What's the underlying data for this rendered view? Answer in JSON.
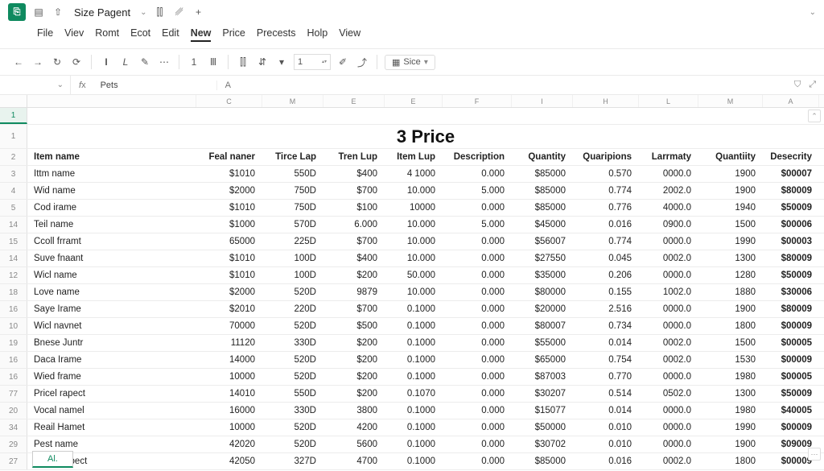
{
  "titlebar": {
    "app_glyph": "⎘",
    "doc_title": "Size Pagent"
  },
  "menubar": [
    "File",
    "Viev",
    "Romt",
    "Ecot",
    "Edit",
    "New",
    "Price",
    "Precests",
    "Holp",
    "View"
  ],
  "menubar_active_index": 5,
  "toolbar": {
    "num_value": "1",
    "size_label": "Sice"
  },
  "formula": {
    "namebox": "",
    "value": "Pets"
  },
  "column_letters": [
    "",
    "C",
    "M",
    "E",
    "E",
    "F",
    "I",
    "H",
    "L",
    "M",
    "A"
  ],
  "sheet_title": "3 Price",
  "headers": [
    "Item name",
    "Feal naner",
    "Tirce Lap",
    "Tren Lup",
    "Item Lup",
    "Description",
    "Quantity",
    "Quaripions",
    "Larrmaty",
    "Quantiity",
    "Desecrity"
  ],
  "row_numbers": [
    "1",
    "1",
    "2",
    "3",
    "4",
    "5",
    "14",
    "15",
    "14",
    "12",
    "18",
    "16",
    "10",
    "19",
    "16",
    "16",
    "77",
    "20",
    "34",
    "29",
    "27"
  ],
  "rows": [
    [
      "Ittm name",
      "$1010",
      "550D",
      "$400",
      "4 1000",
      "0.000",
      "$85000",
      "0.570",
      "0000.0",
      "1900",
      "$00007"
    ],
    [
      "Wid name",
      "$2000",
      "750D",
      "$700",
      "10.000",
      "5.000",
      "$85000",
      "0.774",
      "2002.0",
      "1900",
      "$80009"
    ],
    [
      "Cod irame",
      "$1010",
      "750D",
      "$100",
      "10000",
      "0.000",
      "$85000",
      "0.776",
      "4000.0",
      "1940",
      "$50009"
    ],
    [
      "Teil name",
      "$1000",
      "570D",
      "6.000",
      "10.000",
      "5.000",
      "$45000",
      "0.016",
      "0900.0",
      "1500",
      "$00006"
    ],
    [
      "Ccoll frramt",
      "65000",
      "225D",
      "$700",
      "10.000",
      "0.000",
      "$56007",
      "0.774",
      "0000.0",
      "1990",
      "$00003"
    ],
    [
      "Suve fnaant",
      "$1010",
      "100D",
      "$400",
      "10.000",
      "0.000",
      "$27550",
      "0.045",
      "0002.0",
      "1300",
      "$80009"
    ],
    [
      "Wicl name",
      "$1010",
      "100D",
      "$200",
      "50.000",
      "0.000",
      "$35000",
      "0.206",
      "0000.0",
      "1280",
      "$50009"
    ],
    [
      "Love name",
      "$2000",
      "520D",
      "9879",
      "10.000",
      "0.000",
      "$80000",
      "0.155",
      "1002.0",
      "1880",
      "$30006"
    ],
    [
      "Saye Irame",
      "$2010",
      "220D",
      "$700",
      "0.1000",
      "0.000",
      "$20000",
      "2.516",
      "0000.0",
      "1900",
      "$80009"
    ],
    [
      "Wicl navnet",
      "70000",
      "520D",
      "$500",
      "0.1000",
      "0.000",
      "$80007",
      "0.734",
      "0000.0",
      "1800",
      "$00009"
    ],
    [
      "Bnese Juntr",
      "11120",
      "330D",
      "$200",
      "0.1000",
      "0.000",
      "$55000",
      "0.014",
      "0002.0",
      "1500",
      "$00005"
    ],
    [
      "Daca Irame",
      "14000",
      "520D",
      "$200",
      "0.1000",
      "0.000",
      "$65000",
      "0.754",
      "0002.0",
      "1530",
      "$00009"
    ],
    [
      "Wied frame",
      "10000",
      "520D",
      "$200",
      "0.1000",
      "0.000",
      "$87003",
      "0.770",
      "0000.0",
      "1980",
      "$00005"
    ],
    [
      "Pricel rapect",
      "14010",
      "550D",
      "$200",
      "0.1070",
      "0.000",
      "$30207",
      "0.514",
      "0502.0",
      "1300",
      "$50009"
    ],
    [
      "Vocal namel",
      "16000",
      "330D",
      "3800",
      "0.1000",
      "0.000",
      "$15077",
      "0.014",
      "0000.0",
      "1980",
      "$40005"
    ],
    [
      "Reail Hamet",
      "10000",
      "520D",
      "4200",
      "0.1000",
      "0.000",
      "$50000",
      "0.010",
      "0000.0",
      "1990",
      "$00009"
    ],
    [
      "Pest name",
      "42020",
      "520D",
      "5600",
      "0.1000",
      "0.000",
      "$30702",
      "0.010",
      "0000.0",
      "1900",
      "$09009"
    ],
    [
      "Weet Repect",
      "42050",
      "327D",
      "4700",
      "0.1000",
      "0.000",
      "$85000",
      "0.016",
      "0002.0",
      "1800",
      "$00009"
    ]
  ],
  "sheet_tab": "Al.",
  "chart_data": {
    "type": "table",
    "title": "3 Price",
    "columns": [
      "Item name",
      "Feal naner",
      "Tirce Lap",
      "Tren Lup",
      "Item Lup",
      "Description",
      "Quantity",
      "Quaripions",
      "Larrmaty",
      "Quantiity",
      "Desecrity"
    ]
  }
}
